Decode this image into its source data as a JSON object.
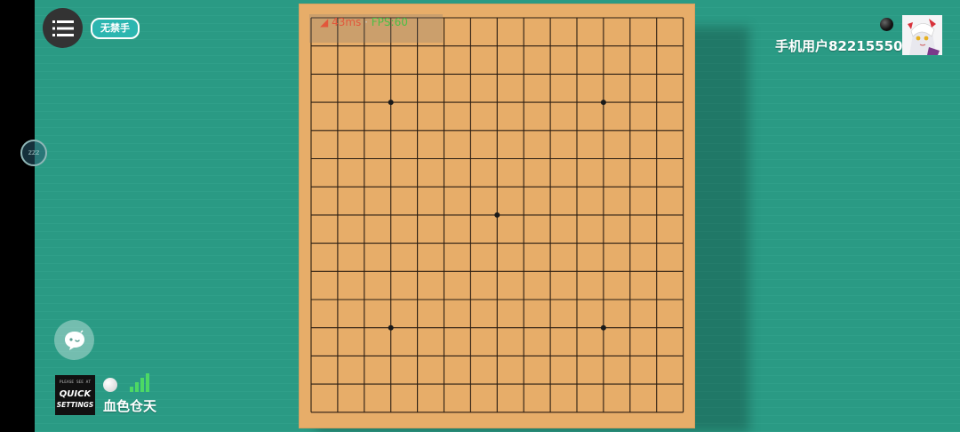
{
  "header": {
    "rule_badge": "无禁手"
  },
  "perf": {
    "ping": "43ms",
    "fps": "FPS:60"
  },
  "opponent": {
    "name": "手机用户82215550",
    "stone": "black"
  },
  "player": {
    "name": "血色仓天",
    "stone": "white",
    "avatar_text_1": "QUICK",
    "avatar_text_2": "SETTINGS",
    "avatar_text_top": "PLEASE SEE AT",
    "signal_bars": 4
  },
  "sleep_label": "zzz",
  "board": {
    "size": 15,
    "star_points": [
      [
        3,
        3
      ],
      [
        11,
        3
      ],
      [
        7,
        7
      ],
      [
        3,
        11
      ],
      [
        11,
        11
      ]
    ]
  },
  "colors": {
    "background": "#2a9a84",
    "board": "#e7ad69",
    "accent": "#2cb6b0"
  }
}
